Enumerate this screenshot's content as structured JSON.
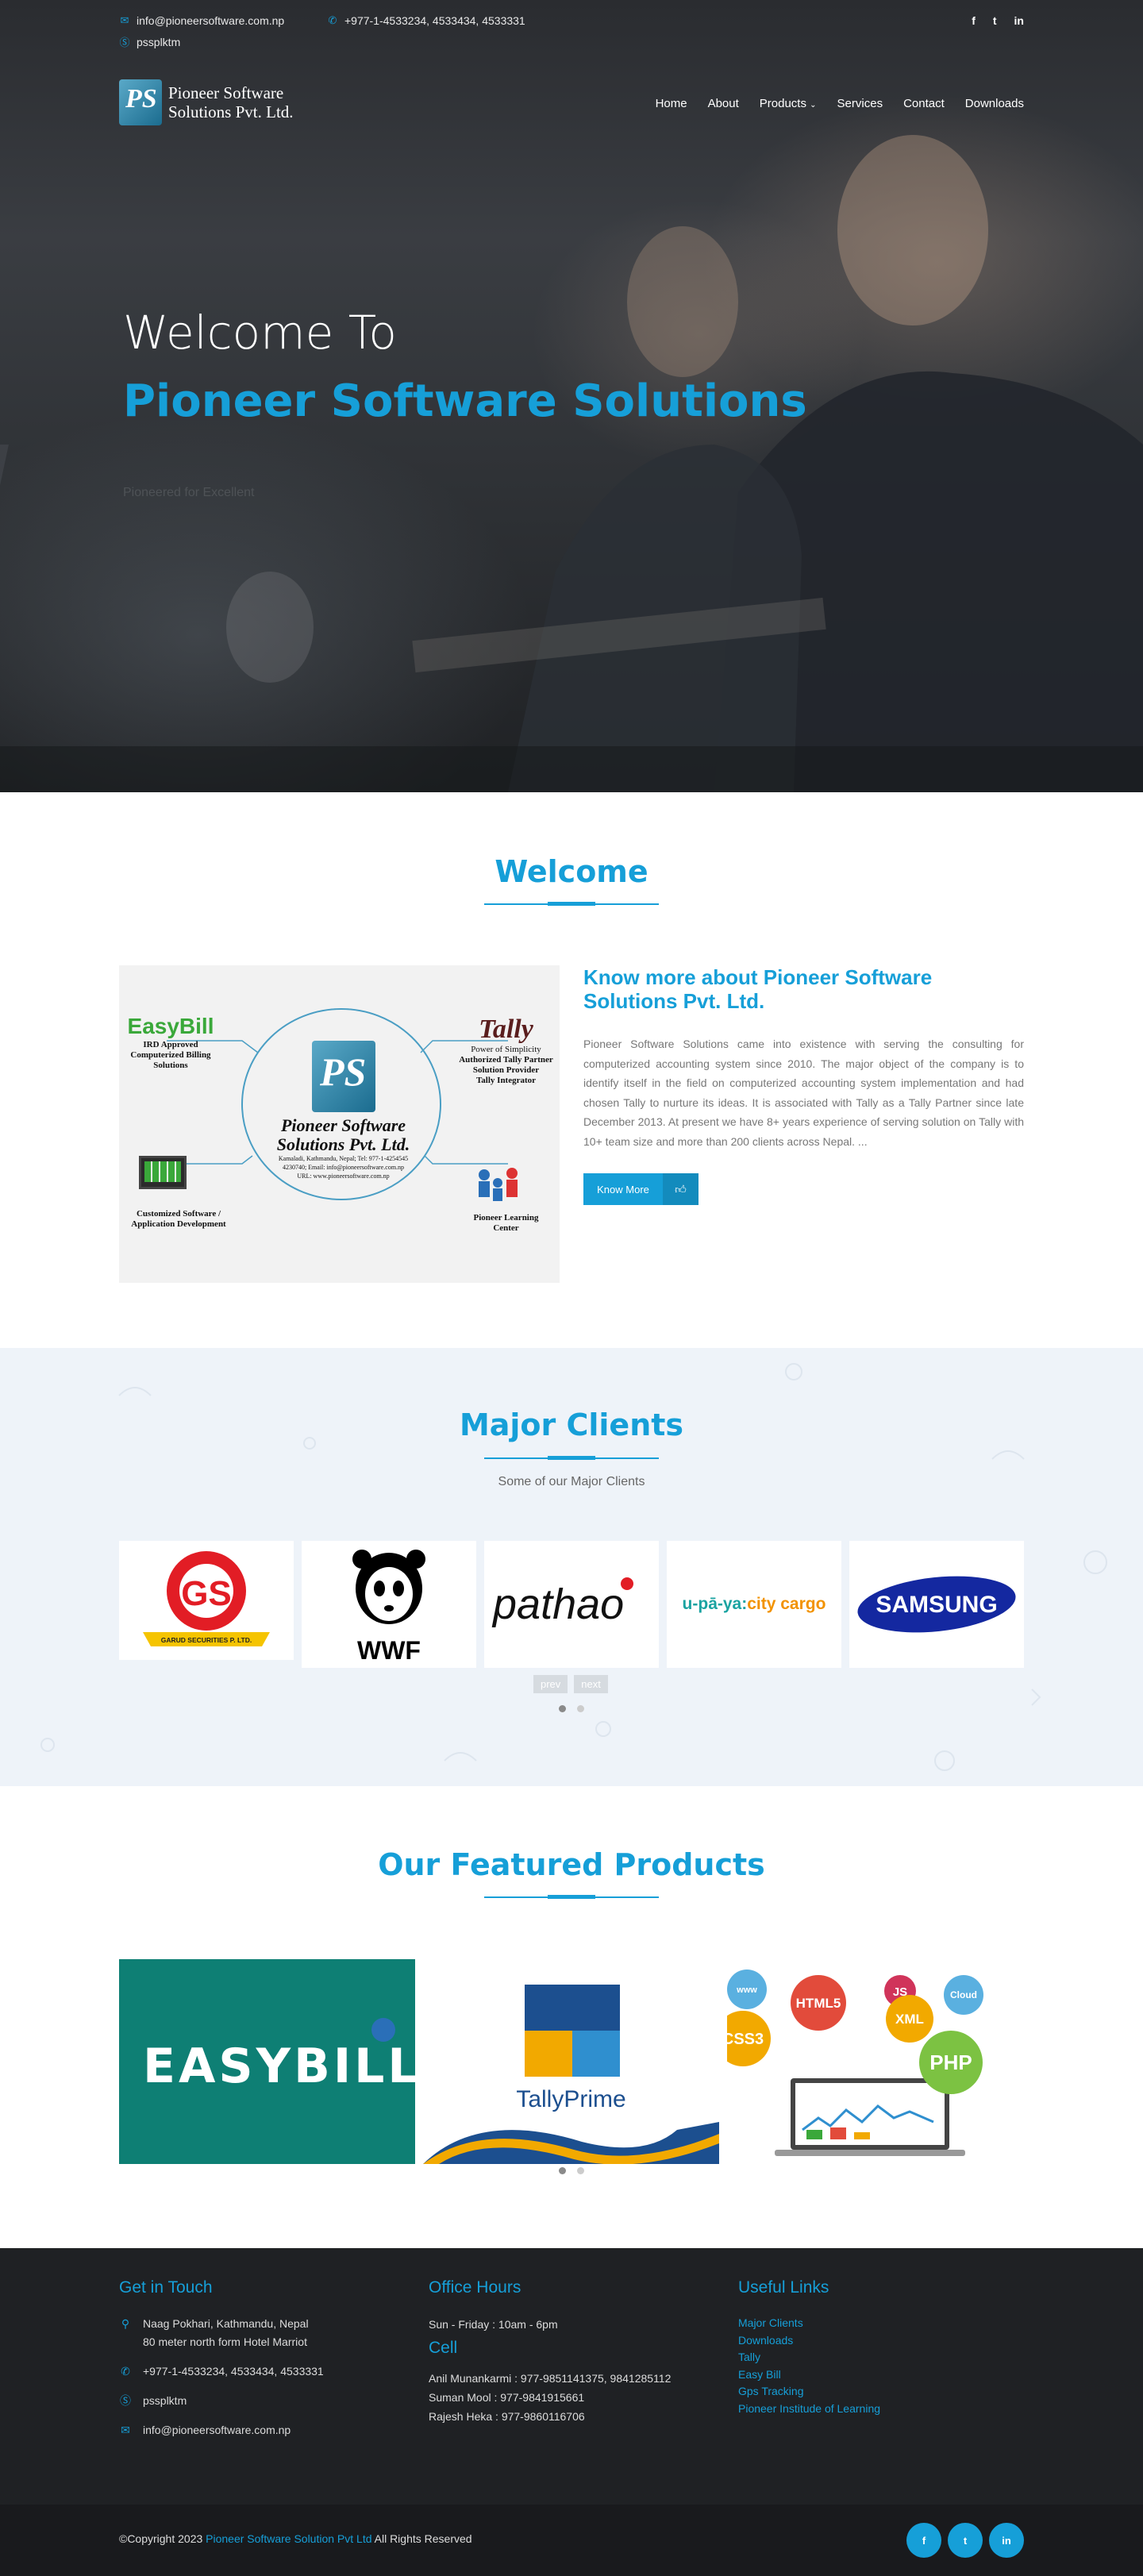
{
  "topbar": {
    "email": "info@pioneersoftware.com.np",
    "phone": "+977-1-4533234, 4533434, 4533331",
    "skype": "pssplktm"
  },
  "brand": {
    "line1": "Pioneer Software",
    "line2": "Solutions Pvt. Ltd.",
    "mark": "PS"
  },
  "nav": {
    "home": "Home",
    "about": "About",
    "products": "Products",
    "services": "Services",
    "contact": "Contact",
    "downloads": "Downloads"
  },
  "hero": {
    "title1": "Welcome To",
    "title2": "Pioneer Software Solutions",
    "tagline": "Pioneered for Excellent"
  },
  "welcome": {
    "heading": "Welcome",
    "about_title": "Know more about Pioneer Software Solutions Pvt. Ltd.",
    "about_text": "Pioneer Software Solutions came into existence with serving the consulting for computerized accounting system since 2010. The major object of the company is to identify itself in the field on computerized accounting system implementation and had chosen Tally to nurture its ideas. It is associated with Tally as a Tally Partner since late December 2013. At present we have 8+ years experience of serving solution on Tally with 10+ team size and more than 200 clients across Nepal. ...",
    "button": "Know More",
    "diagram": {
      "center_line1": "Pioneer Software",
      "center_line2": "Solutions Pvt. Ltd.",
      "center_addr1": "Kamaladi, Kathmandu, Nepal; Tel: 977-1-4254545",
      "center_addr2": "4230740; Email: info@pioneersoftware.com.np",
      "center_addr3": "URL: www.pioneersoftware.com.np",
      "easybill_logo": "EasyBill",
      "easybill_text1": "IRD Approved",
      "easybill_text2": "Computerized Billing",
      "easybill_text3": "Solutions",
      "tally_logo": "Tally",
      "tally_text1": "Power of Simplicity",
      "tally_text2": "Authorized Tally Partner",
      "tally_text3": "Solution Provider",
      "tally_text4": "Tally Integrator",
      "custom_text1": "Customized Software /",
      "custom_text2": "Application Development",
      "learning_text1": "Pioneer Learning",
      "learning_text2": "Center"
    }
  },
  "clients": {
    "heading": "Major Clients",
    "sub": "Some of our Major Clients",
    "prev": "prev",
    "next": "next",
    "logos": {
      "garud": "GARUD SECURITIES P. LTD.",
      "wwf": "WWF",
      "pathao": "pathao",
      "upaya_a": "u-pā-ya:",
      "upaya_b": "city cargo",
      "samsung": "SAMSUNG"
    }
  },
  "products": {
    "heading": "Our Featured Products",
    "easybill": "EASYBILL",
    "tally": "TallyPrime",
    "web_badges": [
      "www",
      "HTML5",
      "JS",
      "Cloud",
      "CSS3",
      "XML",
      "PHP"
    ]
  },
  "footer": {
    "touch": {
      "title": "Get in Touch",
      "addr1": "Naag Pokhari, Kathmandu, Nepal",
      "addr2": "80 meter north form Hotel Marriot",
      "phone": "+977-1-4533234, 4533434, 4533331",
      "skype": "pssplktm",
      "email": "info@pioneersoftware.com.np"
    },
    "office": {
      "title": "Office Hours",
      "hours": "Sun - Friday : 10am - 6pm",
      "cell_title": "Cell",
      "cell1": "Anil Munankarmi : 977-9851141375, 9841285112",
      "cell2": "Suman Mool : 977-9841915661",
      "cell3": "Rajesh Heka : 977-9860116706"
    },
    "links": {
      "title": "Useful Links",
      "items": [
        "Major Clients",
        "Downloads",
        "Tally",
        "Easy Bill",
        "Gps Tracking",
        "Pioneer Institude of Learning"
      ]
    },
    "copyright_a": "©Copyright 2023 ",
    "copyright_link": "Pioneer Software Solution Pvt Ltd",
    "copyright_b": " All Rights Reserved"
  },
  "icons": {
    "accent": "#169fd8"
  }
}
